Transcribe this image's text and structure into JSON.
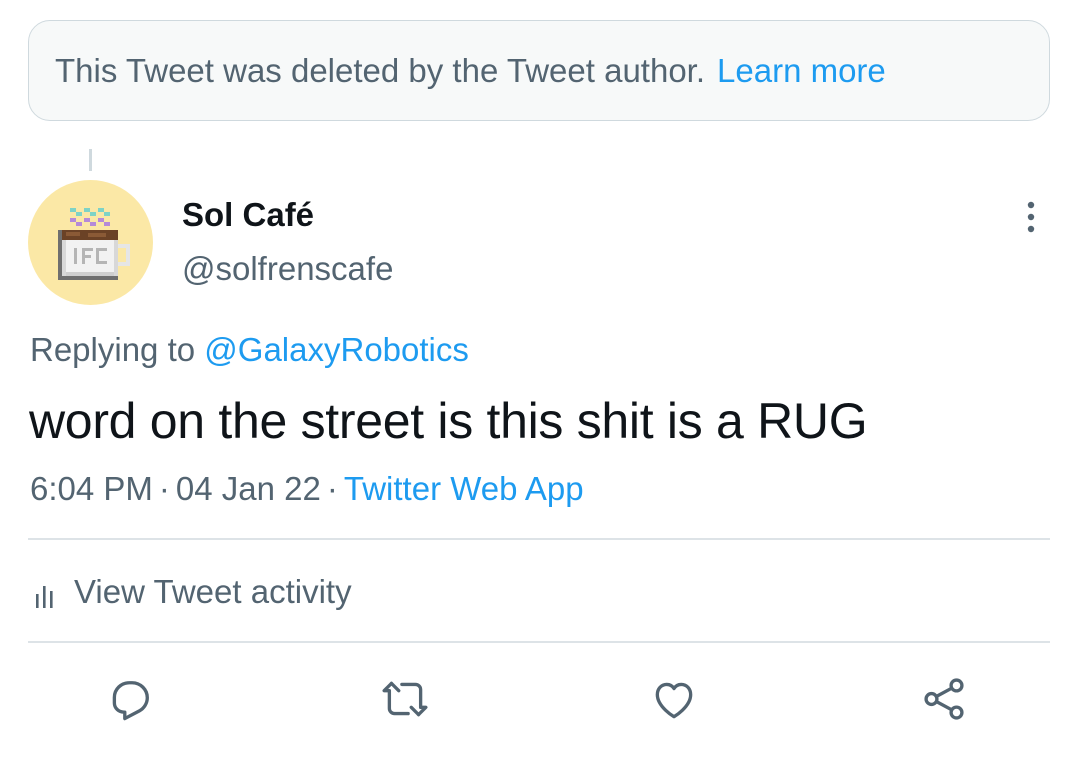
{
  "deleted_notice": {
    "text": "This Tweet was deleted by the Tweet author.",
    "link_label": "Learn more"
  },
  "author": {
    "display_name": "Sol Café",
    "handle": "@solfrenscafe",
    "avatar_icon": "pixel-coffee-mug-icon"
  },
  "reply": {
    "prefix": "Replying to",
    "mention": "@GalaxyRobotics"
  },
  "tweet": {
    "text": "word on the street is this shit is a RUG",
    "time": "6:04 PM",
    "date": "04 Jan 22",
    "separator": "·",
    "source": "Twitter Web App"
  },
  "activity": {
    "label": "View Tweet activity",
    "icon": "bar-chart-icon"
  },
  "actions": [
    {
      "name": "reply",
      "icon": "reply-icon"
    },
    {
      "name": "retweet",
      "icon": "retweet-icon"
    },
    {
      "name": "like",
      "icon": "heart-icon"
    },
    {
      "name": "share",
      "icon": "share-icon"
    }
  ],
  "colors": {
    "accent": "#1d9bf0",
    "secondary_text": "#536471",
    "primary_text": "#0f1419",
    "avatar_bg": "#fbe8a6",
    "notice_bg": "#f7f9f9"
  }
}
